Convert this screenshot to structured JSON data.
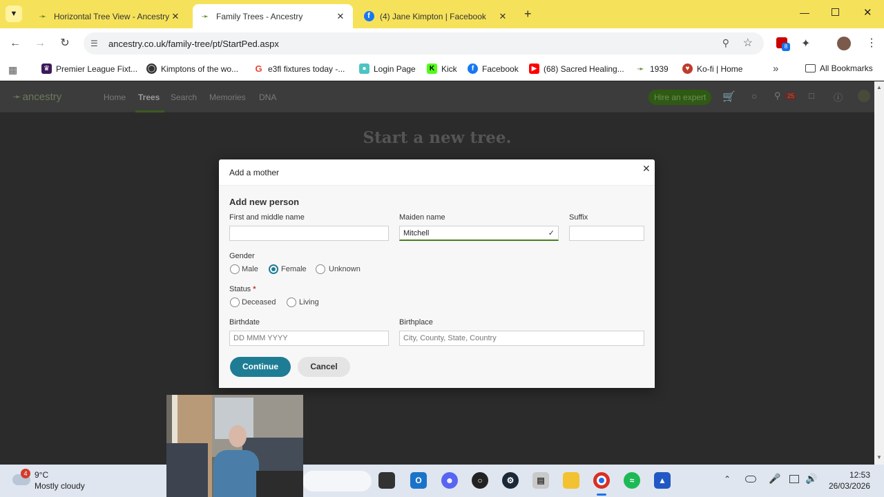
{
  "tabs": [
    {
      "title": "Horizontal Tree View - Ancestry",
      "active": false
    },
    {
      "title": "Family Trees - Ancestry",
      "active": true
    },
    {
      "title": "(4) Jane Kimpton | Facebook",
      "active": false
    }
  ],
  "address": "ancestry.co.uk/family-tree/pt/StartPed.aspx",
  "extension_badge": "8",
  "bookmarks": [
    {
      "label": "Premier League Fixt...",
      "icon": "premier-league-icon"
    },
    {
      "label": "Kimptons of the wo...",
      "icon": "globe-icon"
    },
    {
      "label": "e3fl fixtures today -...",
      "icon": "google-icon"
    },
    {
      "label": "Login Page",
      "icon": "login-icon"
    },
    {
      "label": "Kick",
      "icon": "kick-icon"
    },
    {
      "label": "Facebook",
      "icon": "facebook-icon"
    },
    {
      "label": "(68) Sacred Healing...",
      "icon": "youtube-icon"
    },
    {
      "label": "1939",
      "icon": "ancestry-icon"
    },
    {
      "label": "Ko-fi | Home",
      "icon": "kofi-icon"
    }
  ],
  "all_bookmarks": "All Bookmarks",
  "site": {
    "logo": "ancestry",
    "nav": [
      "Home",
      "Trees",
      "Search",
      "Memories",
      "DNA"
    ],
    "hire": "Hire an expert",
    "notif_count": "25",
    "bg_heading": "Start a new tree."
  },
  "modal": {
    "title": "Add a mother",
    "section": "Add new person",
    "first_label": "First and middle name",
    "first_value": "",
    "maiden_label": "Maiden name",
    "maiden_value": "Mitchell",
    "suffix_label": "Suffix",
    "suffix_value": "",
    "gender_label": "Gender",
    "gender_options": [
      "Male",
      "Female",
      "Unknown"
    ],
    "gender_selected": "Female",
    "status_label": "Status",
    "status_required": "*",
    "status_options": [
      "Deceased",
      "Living"
    ],
    "birthdate_label": "Birthdate",
    "birthdate_placeholder": "DD MMM YYYY",
    "birthplace_label": "Birthplace",
    "birthplace_placeholder": "City, County, State, Country",
    "continue": "Continue",
    "cancel": "Cancel"
  },
  "taskbar": {
    "weather_badge": "4",
    "temp": "9°C",
    "weather": "Mostly cloudy",
    "time": "12:53",
    "date": "26/03/2026"
  },
  "colors": {
    "primary": "#1e7d94",
    "chrome": "#f6e25a",
    "ancestry_green": "#4a8a22"
  }
}
